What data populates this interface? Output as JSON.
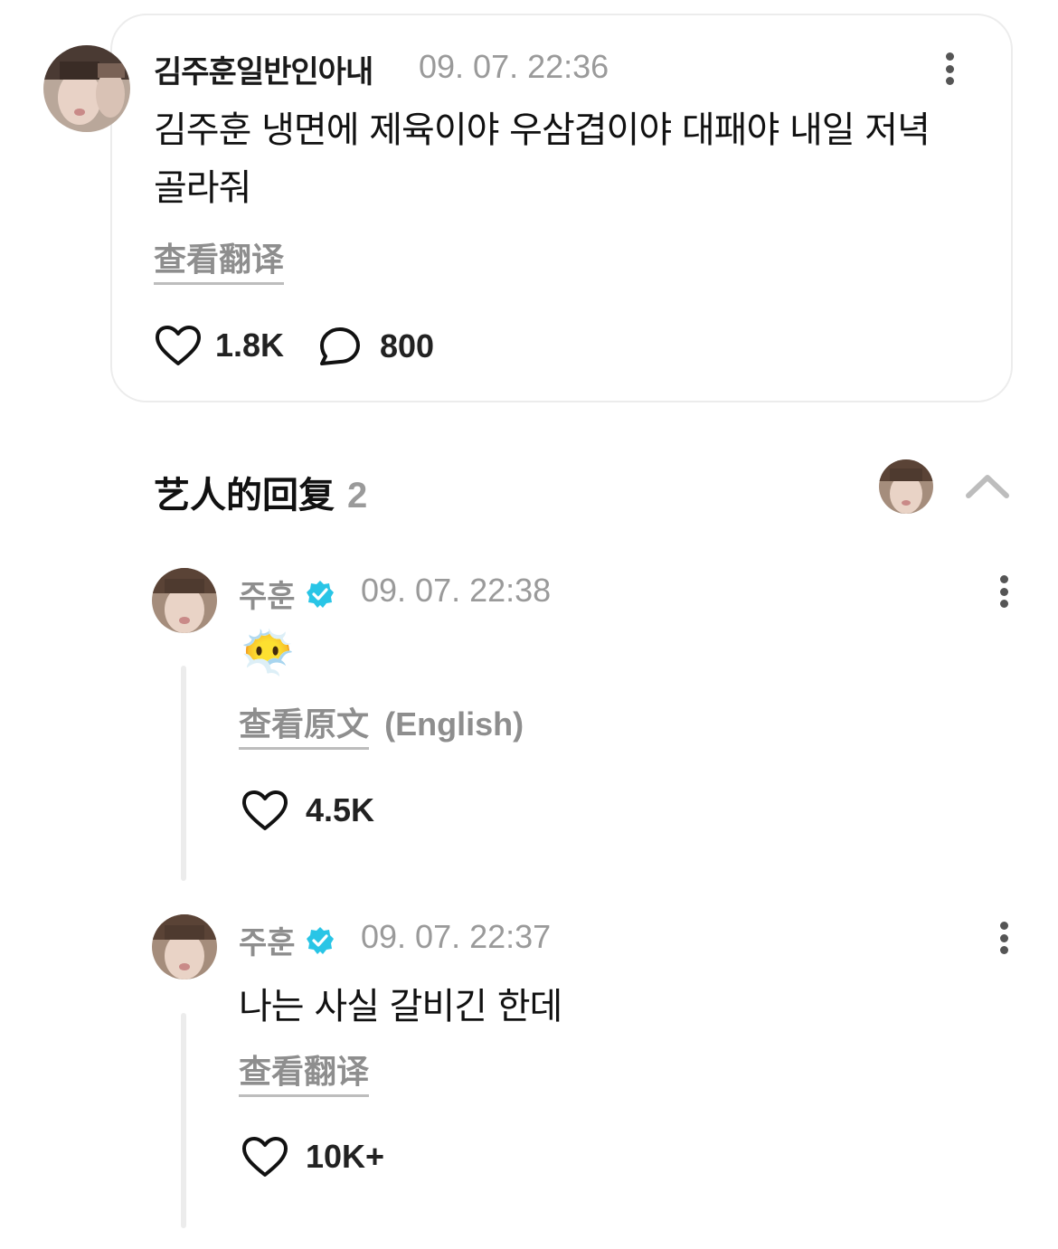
{
  "post": {
    "author": "김주훈일반인아내",
    "time": "09. 07. 22:36",
    "body": "김주훈 냉면에 제육이야 우삼겹이야 대패야 내일 저녁 골라줘",
    "translate_label": "查看翻译",
    "likes": "1.8K",
    "comments": "800"
  },
  "replies_section": {
    "title": "艺人的回复",
    "count": "2"
  },
  "replies": [
    {
      "name": "주훈",
      "time": "09. 07. 22:38",
      "emoji": "😶‍🌫️",
      "original_label": "查看原文",
      "original_lang": "(English)",
      "likes": "4.5K"
    },
    {
      "name": "주훈",
      "time": "09. 07. 22:37",
      "text": "나는 사실 갈비긴 한데",
      "translate_label": "查看翻译",
      "likes": "10K+"
    }
  ],
  "colors": {
    "badge": "#29c5e6",
    "muted": "#9a9a9a",
    "border": "#ececec"
  }
}
